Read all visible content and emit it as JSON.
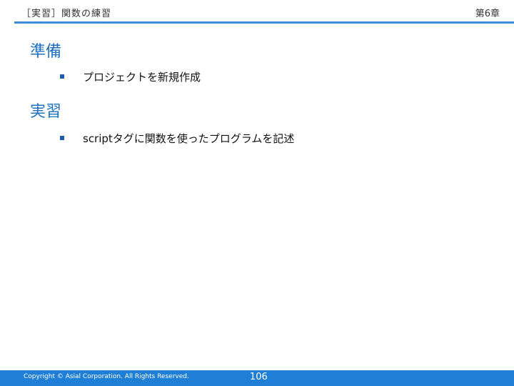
{
  "header": {
    "title": "［実習］関数の練習",
    "chapter": "第6章"
  },
  "sections": [
    {
      "heading": "準備",
      "items": [
        "プロジェクトを新規作成"
      ]
    },
    {
      "heading": "実習",
      "items": [
        "scriptタグに関数を使ったプログラムを記述"
      ]
    }
  ],
  "footer": {
    "copyright": "Copyright © Asial Corporation. All Rights Reserved.",
    "page_number": "106"
  },
  "colors": {
    "accent": "#1f6fbf",
    "rule": "#3a8fd8",
    "footer": "#1f7fd6"
  }
}
